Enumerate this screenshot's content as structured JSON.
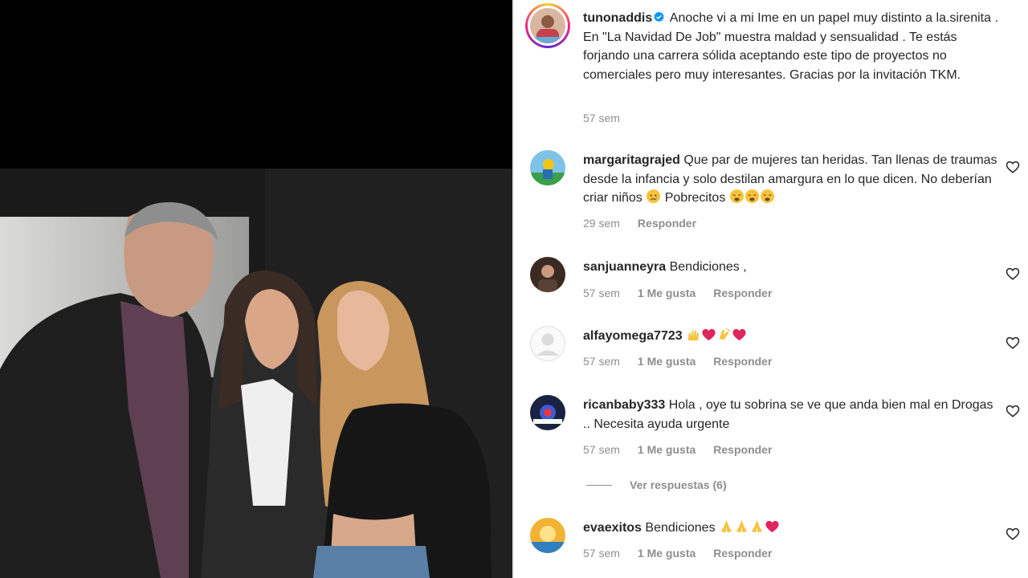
{
  "post": {
    "username": "tunonaddis",
    "caption": "Anoche vi a mi Ime en un papel muy distinto a la.sirenita . En \"La Navidad De Job\" muestra maldad y sensualidad . Te estás forjando una carrera sólida aceptando este tipo de proyectos no comerciales pero muy interesantes. Gracias por la invitación TKM.",
    "time": "57 sem"
  },
  "comments": [
    {
      "username": "margaritagrajed",
      "text": "Que par de mujeres tan heridas. Tan llenas de traumas desde la infancia y solo destilan amargura en lo que dicen. No deberían criar niños",
      "text_after": "Pobrecitos",
      "time": "29 sem",
      "likes": "",
      "reply": "Responder"
    },
    {
      "username": "sanjuanneyra",
      "text": "Bendiciones ,",
      "time": "57 sem",
      "likes": "1 Me gusta",
      "reply": "Responder"
    },
    {
      "username": "alfayomega7723",
      "text": "",
      "time": "57 sem",
      "likes": "1 Me gusta",
      "reply": "Responder"
    },
    {
      "username": "ricanbaby333",
      "text": "Hola , oye tu sobrina se ve que anda bien mal en Drogas .. Necesita ayuda urgente",
      "time": "57 sem",
      "likes": "1 Me gusta",
      "reply": "Responder"
    },
    {
      "username": "evaexitos",
      "text": "Bendiciones",
      "time": "57 sem",
      "likes": "1 Me gusta",
      "reply": "Responder"
    }
  ],
  "view_replies": "Ver respuestas (6)",
  "icons": {
    "verified": "verified-badge-icon",
    "like": "heart-outline-icon",
    "default_avatar": "default-avatar-icon"
  },
  "colors": {
    "verified": "#0095f6",
    "secondary_text": "#8e8e8e",
    "heart_emoji": "#e0245e"
  }
}
